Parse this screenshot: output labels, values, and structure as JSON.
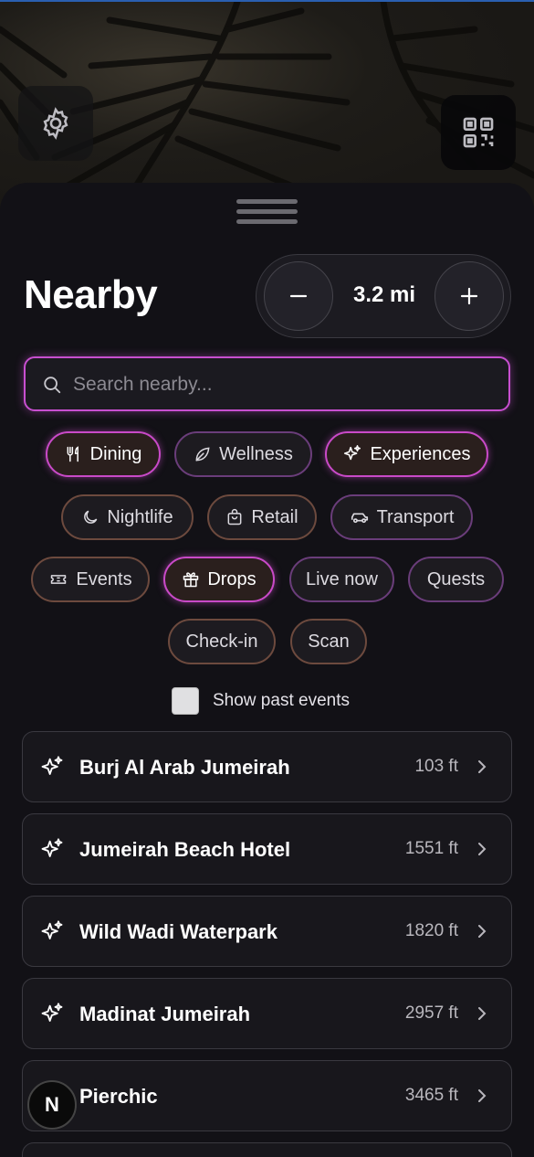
{
  "header": {
    "title": "Nearby"
  },
  "radius": {
    "value": "3.2 mi",
    "decrement": "−",
    "increment": "+"
  },
  "search": {
    "placeholder": "Search nearby..."
  },
  "filters": [
    {
      "label": "Dining",
      "icon": "utensils-icon",
      "active": true
    },
    {
      "label": "Wellness",
      "icon": "leaf-icon",
      "active": false
    },
    {
      "label": "Experiences",
      "icon": "sparkles-icon",
      "active": true
    },
    {
      "label": "Nightlife",
      "icon": "moon-icon",
      "active": false
    },
    {
      "label": "Retail",
      "icon": "shopping-bag-icon",
      "active": false
    },
    {
      "label": "Transport",
      "icon": "car-icon",
      "active": false
    },
    {
      "label": "Events",
      "icon": "ticket-icon",
      "active": false
    },
    {
      "label": "Drops",
      "icon": "gift-icon",
      "active": true
    },
    {
      "label": "Live now",
      "icon": "",
      "active": false
    },
    {
      "label": "Quests",
      "icon": "",
      "active": false
    },
    {
      "label": "Check-in",
      "icon": "",
      "active": false
    },
    {
      "label": "Scan",
      "icon": "",
      "active": false
    }
  ],
  "past_events": {
    "label": "Show past events",
    "checked": false
  },
  "places": [
    {
      "name": "Burj Al Arab Jumeirah",
      "distance": "103 ft",
      "icon": "sparkles-icon"
    },
    {
      "name": "Jumeirah Beach Hotel",
      "distance": "1551 ft",
      "icon": "sparkles-icon"
    },
    {
      "name": "Wild Wadi Waterpark",
      "distance": "1820 ft",
      "icon": "sparkles-icon"
    },
    {
      "name": "Madinat Jumeirah",
      "distance": "2957 ft",
      "icon": "sparkles-icon"
    },
    {
      "name": "Pierchic",
      "distance": "3465 ft",
      "icon": "utensils-icon"
    }
  ],
  "avatar": {
    "initial": "N"
  },
  "colors": {
    "accent": "#c94ac8",
    "chip_border": "#6d4a3e",
    "sheet_bg": "#121116"
  }
}
